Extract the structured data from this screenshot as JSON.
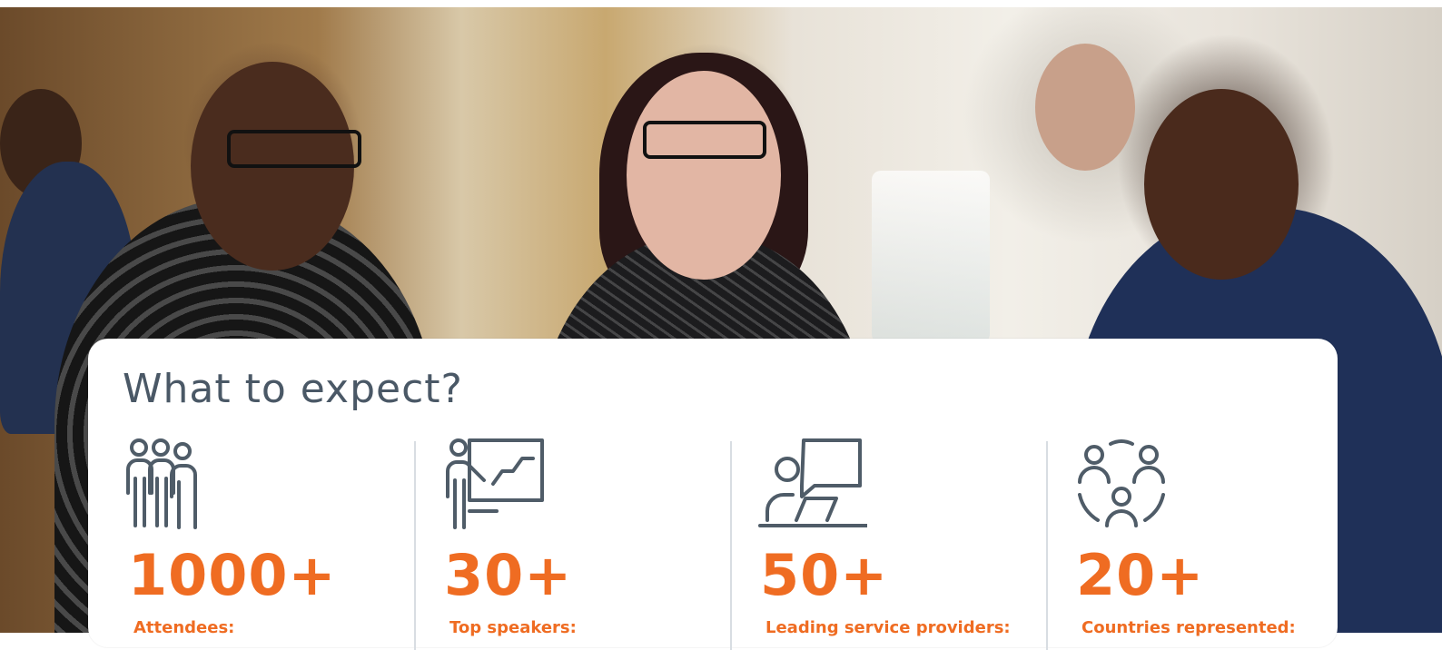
{
  "section": {
    "title": "What to expect?"
  },
  "stats": [
    {
      "number": "1000+",
      "label": "Attendees:",
      "icon": "attendees-group-icon"
    },
    {
      "number": "30+",
      "label": "Top speakers:",
      "icon": "speaker-presentation-icon"
    },
    {
      "number": "50+",
      "label": "Leading service providers:",
      "icon": "service-provider-chat-icon"
    },
    {
      "number": "20+",
      "label": "Countries represented:",
      "icon": "countries-network-icon"
    }
  ],
  "colors": {
    "accent": "#ef6c22",
    "title": "#4a5866",
    "icon_stroke": "#4f5c68",
    "divider": "#d8dde2"
  }
}
